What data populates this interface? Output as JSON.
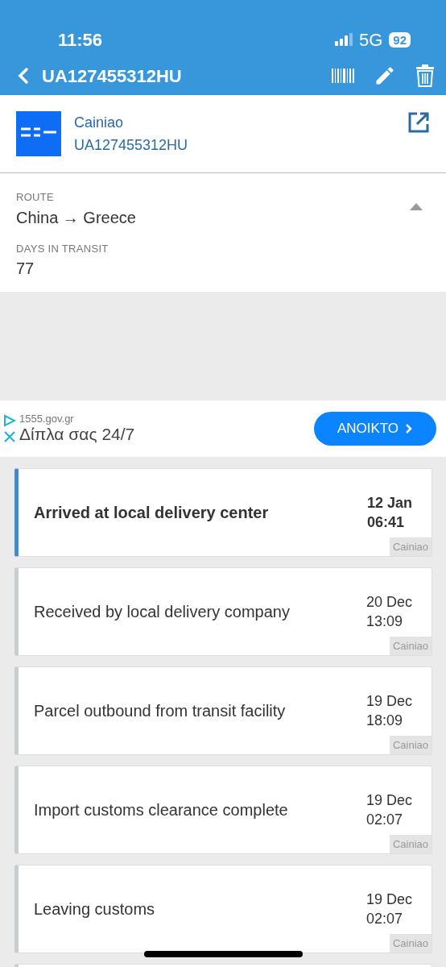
{
  "status_bar": {
    "time": "11:56",
    "network": "5G",
    "battery": "92"
  },
  "header": {
    "title": "UA127455312HU"
  },
  "carrier": {
    "name": "Cainiao",
    "tracking_number": "UA127455312HU"
  },
  "details": {
    "expanded": true,
    "fields": [
      {
        "label": "ROUTE",
        "value": "China → Greece"
      },
      {
        "label": "DAYS IN TRANSIT",
        "value": "77"
      }
    ]
  },
  "ad": {
    "domain": "1555.gov.gr",
    "headline": "Δίπλα σας 24/7",
    "button": "ΑΝΟΙΚΤΟ"
  },
  "events": [
    {
      "status": "Arrived at local delivery center",
      "date": "12 Jan",
      "time": "06:41",
      "source": "Cainiao",
      "selected": true
    },
    {
      "status": "Received by local  delivery company",
      "date": "20 Dec",
      "time": "13:09",
      "source": "Cainiao",
      "selected": false
    },
    {
      "status": "Parcel outbound from transit facility",
      "date": "19 Dec",
      "time": "18:09",
      "source": "Cainiao",
      "selected": false
    },
    {
      "status": "Import customs clearance complete",
      "date": "19 Dec",
      "time": "02:07",
      "source": "Cainiao",
      "selected": false
    },
    {
      "status": "Leaving customs",
      "date": "19 Dec",
      "time": "02:07",
      "source": "Cainiao",
      "selected": false
    }
  ]
}
